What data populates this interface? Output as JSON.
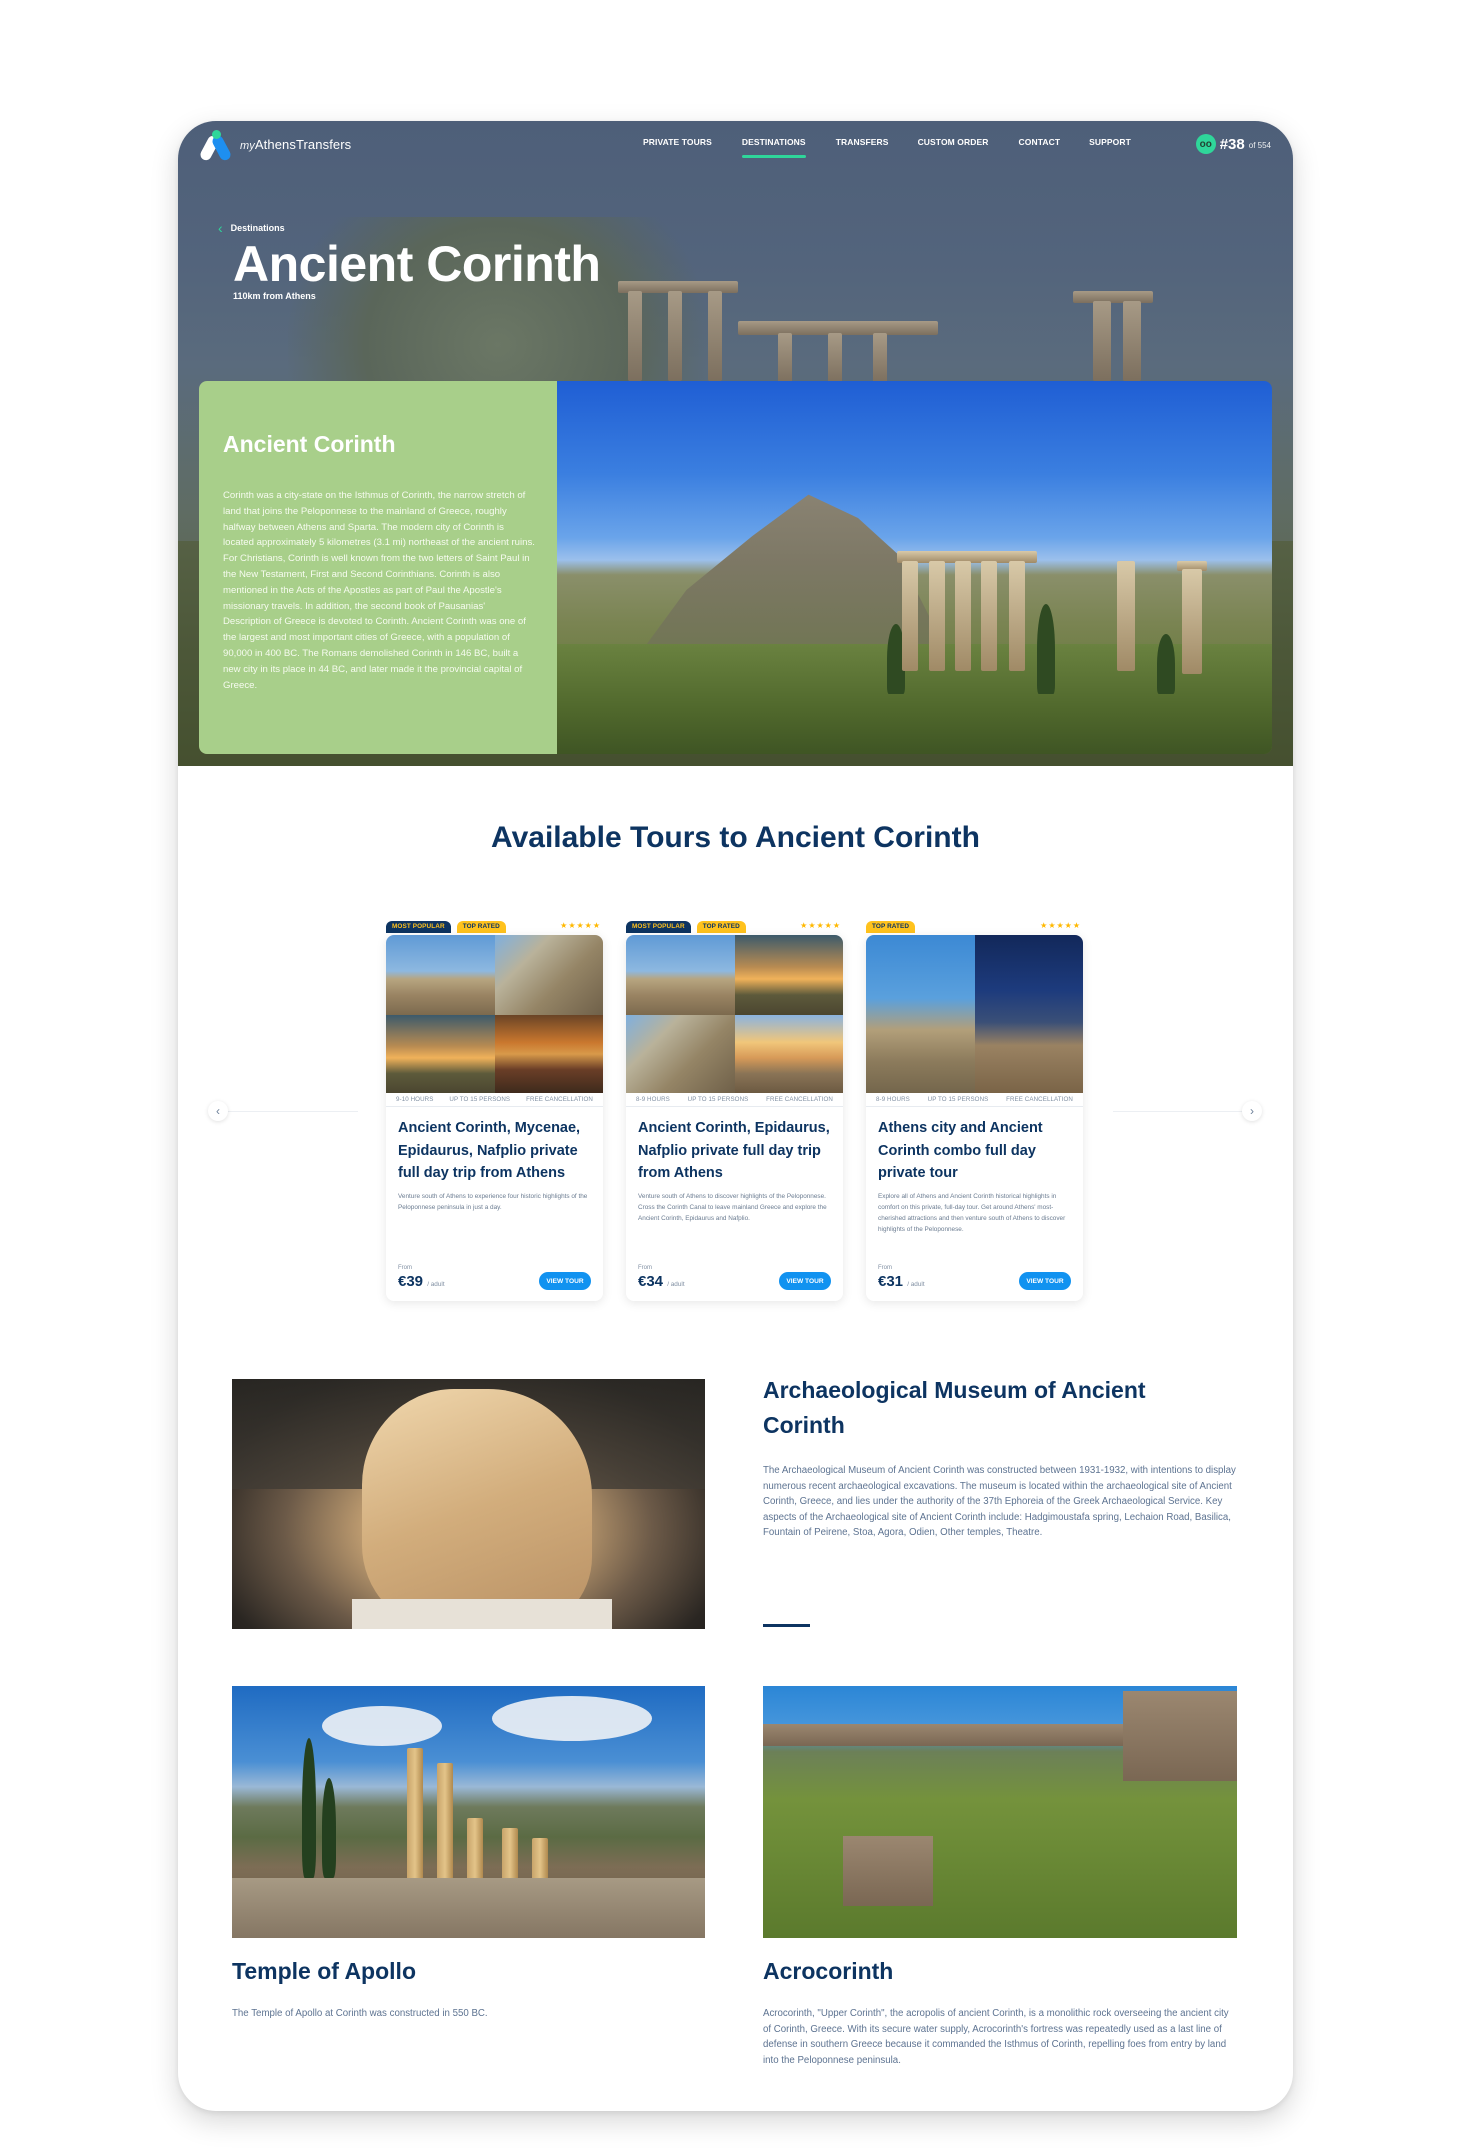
{
  "nav": {
    "logo_prefix": "my",
    "logo_name": "AthensTransfers",
    "links": [
      {
        "label": "PRIVATE TOURS",
        "active": false
      },
      {
        "label": "DESTINATIONS",
        "active": true
      },
      {
        "label": "TRANSFERS",
        "active": false
      },
      {
        "label": "CUSTOM ORDER",
        "active": false
      },
      {
        "label": "CONTACT",
        "active": false
      },
      {
        "label": "SUPPORT",
        "active": false
      }
    ],
    "tripadvisor_icon": "tripadvisor-owl-icon",
    "rank": "#38",
    "rank_of": "of 554"
  },
  "hero": {
    "breadcrumb": "Destinations",
    "title": "Ancient Corinth",
    "subtitle": "110km from Athens"
  },
  "intro": {
    "title": "Ancient Corinth",
    "text": "Corinth was a city-state on the Isthmus of Corinth, the narrow stretch of land that joins the Peloponnese to the mainland of Greece, roughly halfway between Athens and Sparta. The modern city of Corinth is located approximately 5 kilometres (3.1 mi) northeast of the ancient ruins. For Christians, Corinth is well known from the two letters of Saint Paul in the New Testament, First and Second Corinthians. Corinth is also mentioned in the Acts of the Apostles as part of Paul the Apostle's missionary travels. In addition, the second book of Pausanias' Description of Greece is devoted to Corinth. Ancient Corinth was one of the largest and most important cities of Greece, with a population of 90,000 in 400 BC. The Romans demolished Corinth in 146 BC, built a new city in its place in 44 BC, and later made it the provincial capital of Greece."
  },
  "tours_section": {
    "title": "Available Tours to Ancient Corinth",
    "prev_icon": "chevron-left-icon",
    "next_icon": "chevron-right-icon",
    "tours": [
      {
        "tags": [
          "MOST POPULAR",
          "TOP RATED"
        ],
        "rating_stars": 5,
        "stars": "★★★★★",
        "duration": "9-10 HOURS",
        "capacity": "UP TO 15 PERSONS",
        "cancellation": "FREE CANCELLATION",
        "name": "Ancient Corinth, Mycenae, Epidaurus, Nafplio private full day trip from Athens",
        "description": "Venture south of Athens to experience four historic highlights of the Peloponnese peninsula in just a day.",
        "from_label": "From",
        "price": "€39",
        "unit": "/ adult",
        "button": "VIEW TOUR"
      },
      {
        "tags": [
          "MOST POPULAR",
          "TOP RATED"
        ],
        "rating_stars": 5,
        "stars": "★★★★★",
        "duration": "8-9 HOURS",
        "capacity": "UP TO 15 PERSONS",
        "cancellation": "FREE CANCELLATION",
        "name": "Ancient Corinth, Epidaurus, Nafplio private full day trip from Athens",
        "description": "Venture south of Athens to discover highlights of the Peloponnese. Cross the Corinth Canal to leave mainland Greece and explore the Ancient Corinth, Epidaurus and Nafplio.",
        "from_label": "From",
        "price": "€34",
        "unit": "/ adult",
        "button": "VIEW TOUR"
      },
      {
        "tags": [
          "TOP RATED"
        ],
        "rating_stars": 5,
        "stars": "★★★★★",
        "duration": "8-9 HOURS",
        "capacity": "UP TO 15 PERSONS",
        "cancellation": "FREE CANCELLATION",
        "name": "Athens city and Ancient Corinth combo full day private tour",
        "description": "Explore all of Athens and Ancient Corinth historical highlights in comfort on this private, full-day tour. Get around Athens' most-cherished attractions and then venture south of Athens to discover highlights of the Peloponnese.",
        "from_label": "From",
        "price": "€31",
        "unit": "/ adult",
        "button": "VIEW TOUR"
      }
    ]
  },
  "sections": [
    {
      "title": "Archaeological Museum of Ancient Corinth",
      "text": "The Archaeological Museum of Ancient Corinth was constructed between 1931-1932, with intentions to display numerous recent archaeological excavations. The museum is located within the archaeological site of Ancient Corinth, Greece, and lies under the authority of the 37th Ephoreia of the Greek Archaeological Service. Key aspects of the Archaeological site of Ancient Corinth include: Hadgimoustafa spring, Lechaion Road, Basilica, Fountain of Peirene, Stoa, Agora, Odien, Other temples, Theatre."
    },
    {
      "title": "Temple of Apollo",
      "text": "The Temple of Apollo at Corinth was constructed in 550 BC."
    },
    {
      "title": "Acrocorinth",
      "text": "Acrocorinth, \"Upper Corinth\", the acropolis of ancient Corinth, is a monolithic rock overseeing the ancient city of Corinth, Greece. With its secure water supply, Acrocorinth's fortress was repeatedly used as a last line of defense in southern Greece because it commanded the Isthmus of Corinth, repelling foes from entry by land into the Peloponnese peninsula."
    }
  ],
  "colors": {
    "brand_navy": "#0d3461",
    "accent_green": "#2fd69a",
    "intro_green": "#a8cf8a",
    "button_blue": "#1192f0",
    "tag_yellow": "#ffc21d"
  }
}
